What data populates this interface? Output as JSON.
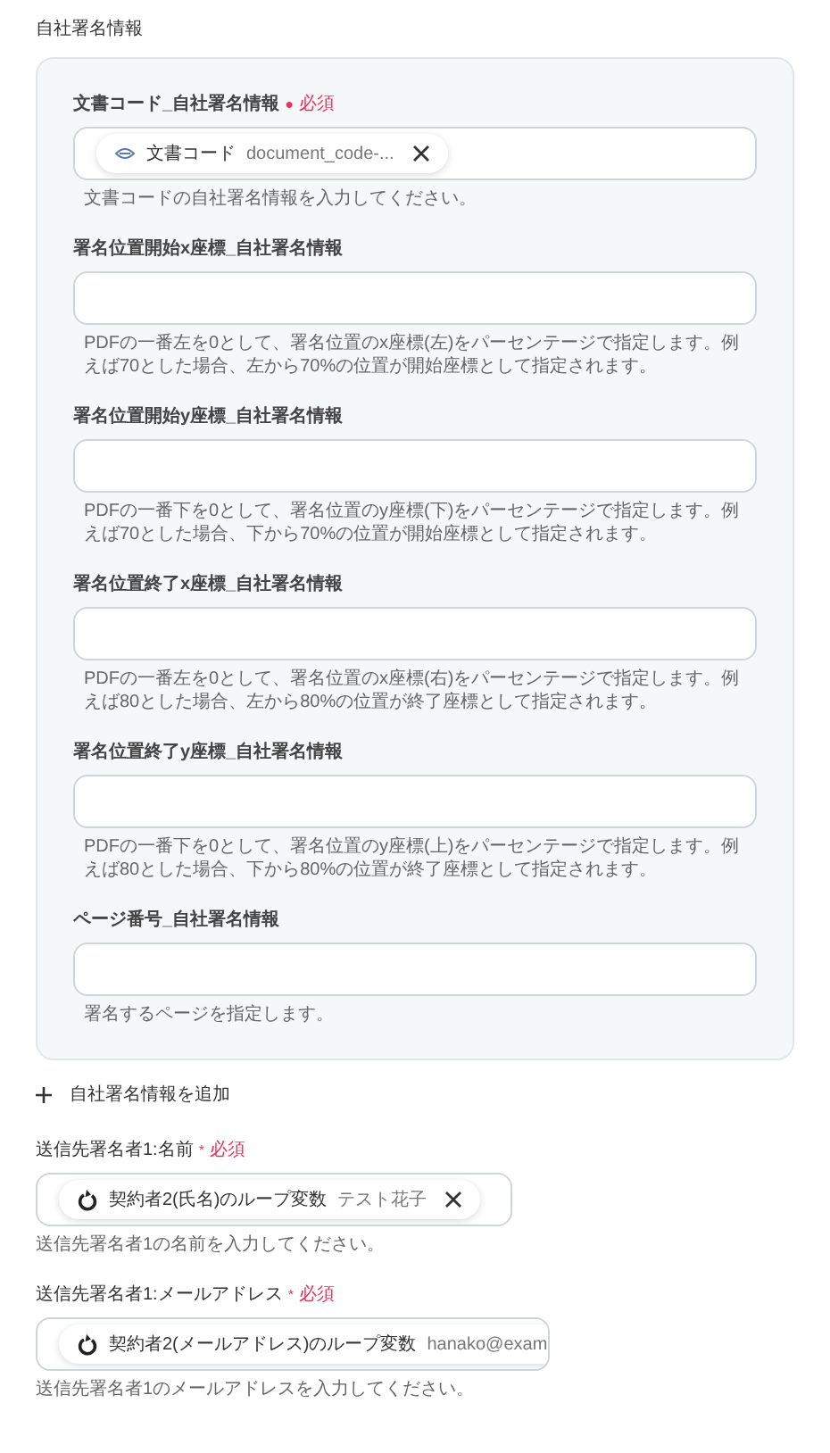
{
  "section_title": "自社署名情報",
  "panel_fields": [
    {
      "label": "文書コード_自社署名情報",
      "required": {
        "mark": "●",
        "text": "必須"
      },
      "chip": {
        "kind": "variable",
        "label": "文書コード",
        "value": "document_code-...",
        "removable": true
      },
      "help": "文書コードの自社署名情報を入力してください。"
    },
    {
      "label": "署名位置開始x座標_自社署名情報",
      "help": "PDFの一番左を0として、署名位置のx座標(左)をパーセンテージで指定します。例えば70とした場合、左から70%の位置が開始座標として指定されます。"
    },
    {
      "label": "署名位置開始y座標_自社署名情報",
      "help": "PDFの一番下を0として、署名位置のy座標(下)をパーセンテージで指定します。例えば70とした場合、下から70%の位置が開始座標として指定されます。"
    },
    {
      "label": "署名位置終了x座標_自社署名情報",
      "help": "PDFの一番左を0として、署名位置のx座標(右)をパーセンテージで指定します。例えば80とした場合、左から80%の位置が終了座標として指定されます。"
    },
    {
      "label": "署名位置終了y座標_自社署名情報",
      "help": "PDFの一番下を0として、署名位置のy座標(上)をパーセンテージで指定します。例えば80とした場合、下から80%の位置が終了座標として指定されます。"
    },
    {
      "label": "ページ番号_自社署名情報",
      "help": "署名するページを指定します。"
    }
  ],
  "add_button": {
    "label": "自社署名情報を追加"
  },
  "fields": [
    {
      "label": "送信先署名者1:名前",
      "required": {
        "mark": "*",
        "text": "必須"
      },
      "chip": {
        "kind": "loop",
        "label": "契約者2(氏名)のループ変数",
        "value": "テスト花子",
        "removable": true
      },
      "help": "送信先署名者1の名前を入力してください。"
    },
    {
      "label": "送信先署名者1:メールアドレス",
      "required": {
        "mark": "*",
        "text": "必須"
      },
      "chip": {
        "kind": "loop",
        "label": "契約者2(メールアドレス)のループ変数",
        "value": "hanako@exam",
        "removable": false
      },
      "help": "送信先署名者1のメールアドレスを入力してください。"
    }
  ]
}
